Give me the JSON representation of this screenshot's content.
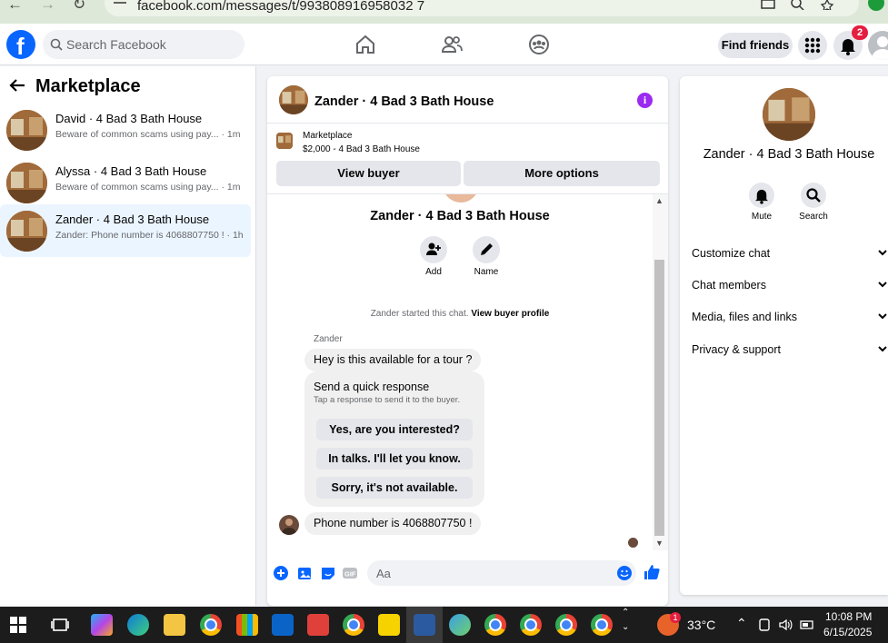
{
  "browser": {
    "url": "facebook.com/messages/t/993808916958032 7"
  },
  "topbar": {
    "search_placeholder": "Search Facebook",
    "find_friends": "Find friends",
    "notification_count": "2"
  },
  "marketplace": {
    "title": "Marketplace",
    "threads": [
      {
        "name": "David · 4 Bad 3 Bath House",
        "preview": "Beware of common scams using pay... · 1m",
        "active": false
      },
      {
        "name": "Alyssa · 4 Bad 3 Bath House",
        "preview": "Beware of common scams using pay... · 1m",
        "active": false
      },
      {
        "name": "Zander · 4 Bad 3 Bath House",
        "preview": "Zander: Phone number is 4068807750 ! · 1h",
        "active": true
      }
    ]
  },
  "chat": {
    "title": "Zander · 4 Bad 3 Bath House",
    "listing_kind": "Marketplace",
    "listing_price": "$2,000 - 4 Bad 3 Bath House",
    "view_buyer": "View buyer",
    "more_options": "More options",
    "convo_name": "Zander · 4 Bad 3 Bath House",
    "action_add": "Add",
    "action_name": "Name",
    "started_text": "Zander started this chat.",
    "started_link": "View buyer profile",
    "sender": "Zander",
    "message1": "Hey is this available for a tour ?",
    "quick_title": "Send a quick response",
    "quick_sub": "Tap a response to send it to the buyer.",
    "quick_replies": [
      "Yes, are you interested?",
      "In talks. I'll let you know.",
      "Sorry, it's not available."
    ],
    "message2": "Phone number is 4068807750 !",
    "composer_placeholder": "Aa"
  },
  "info_panel": {
    "name": "Zander · 4 Bad 3 Bath House",
    "mute": "Mute",
    "search": "Search",
    "rows": [
      "Customize chat",
      "Chat members",
      "Media, files and links",
      "Privacy & support"
    ]
  },
  "taskbar": {
    "temperature": "33°C",
    "time": "10:08 PM",
    "date": "6/15/2025",
    "weather_badge": "1"
  },
  "colors": {
    "fb_blue": "#0866ff",
    "active_thread": "#ebf5ff",
    "info_purple": "#9b2bf0",
    "notification_red": "#e41e3f"
  }
}
